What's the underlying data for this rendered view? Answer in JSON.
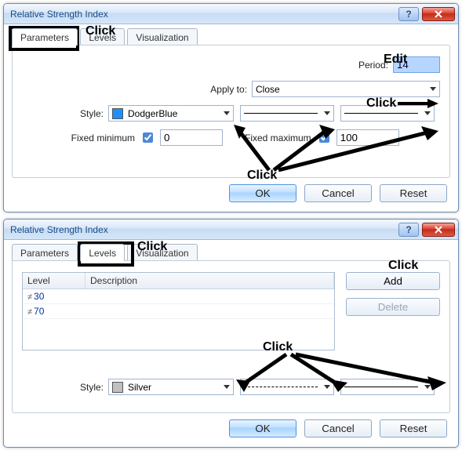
{
  "d1": {
    "title": "Relative Strength Index",
    "tabs": {
      "parameters": "Parameters",
      "levels": "Levels",
      "visualization": "Visualization"
    },
    "fields": {
      "period_label": "Period:",
      "period_value": "14",
      "apply_label": "Apply to:",
      "apply_value": "Close",
      "style_label": "Style:",
      "style_value": "DodgerBlue",
      "fixmin_label": "Fixed minimum",
      "fixmin_value": "0",
      "fixmax_label": "Fixed maximum",
      "fixmax_value": "100"
    },
    "buttons": {
      "ok": "OK",
      "cancel": "Cancel",
      "reset": "Reset"
    },
    "anno": {
      "click_tab": "Click",
      "edit": "Edit",
      "click_apply": "Click",
      "click_style": "Click"
    }
  },
  "d2": {
    "title": "Relative Strength Index",
    "tabs": {
      "parameters": "Parameters",
      "levels": "Levels",
      "visualization": "Visualization"
    },
    "list": {
      "hdr_level": "Level",
      "hdr_desc": "Description",
      "rows": [
        {
          "level": "30",
          "desc": ""
        },
        {
          "level": "70",
          "desc": ""
        }
      ]
    },
    "side": {
      "add": "Add",
      "delete": "Delete"
    },
    "style_label": "Style:",
    "style_value": "Silver",
    "buttons": {
      "ok": "OK",
      "cancel": "Cancel",
      "reset": "Reset"
    },
    "anno": {
      "click_tab": "Click",
      "click_add": "Click",
      "click_style": "Click"
    }
  }
}
